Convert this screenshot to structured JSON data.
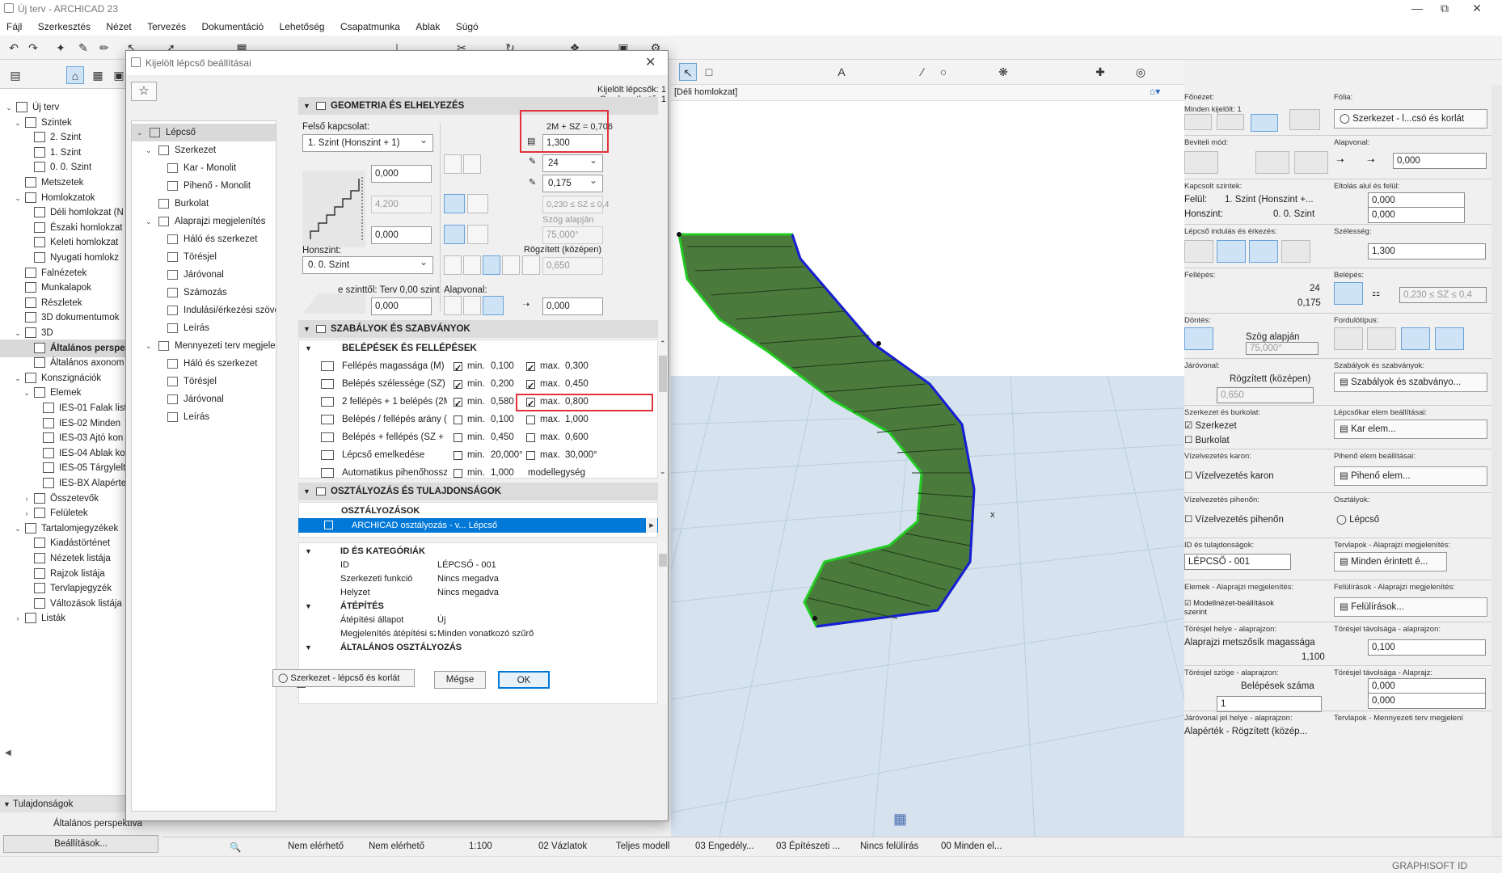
{
  "app": {
    "title": "Új terv - ARCHICAD 23",
    "menu": [
      "Fájl",
      "Szerkesztés",
      "Nézet",
      "Tervezés",
      "Dokumentáció",
      "Lehetőség",
      "Csapatmunka",
      "Ablak",
      "Súgó"
    ]
  },
  "navigator": {
    "items": [
      {
        "label": "Új terv",
        "lvl": 0,
        "ar": "v"
      },
      {
        "label": "Szintek",
        "lvl": 1,
        "ar": "v"
      },
      {
        "label": "2. Szint",
        "lvl": 2,
        "ar": ""
      },
      {
        "label": "1. Szint",
        "lvl": 2,
        "ar": ""
      },
      {
        "label": "0. 0. Szint",
        "lvl": 2,
        "ar": ""
      },
      {
        "label": "Metszetek",
        "lvl": 1,
        "ar": ""
      },
      {
        "label": "Homlokzatok",
        "lvl": 1,
        "ar": "v"
      },
      {
        "label": "Déli homlokzat (N",
        "lvl": 2,
        "ar": ""
      },
      {
        "label": "Északi homlokzat",
        "lvl": 2,
        "ar": ""
      },
      {
        "label": "Keleti homlokzat",
        "lvl": 2,
        "ar": ""
      },
      {
        "label": "Nyugati homlokz",
        "lvl": 2,
        "ar": ""
      },
      {
        "label": "Falnézetek",
        "lvl": 1,
        "ar": ""
      },
      {
        "label": "Munkalapok",
        "lvl": 1,
        "ar": ""
      },
      {
        "label": "Részletek",
        "lvl": 1,
        "ar": ""
      },
      {
        "label": "3D dokumentumok",
        "lvl": 1,
        "ar": ""
      },
      {
        "label": "3D",
        "lvl": 1,
        "ar": "v"
      },
      {
        "label": "Általános perspe",
        "lvl": 2,
        "ar": "",
        "sel": true
      },
      {
        "label": "Általános axonom",
        "lvl": 2,
        "ar": ""
      },
      {
        "label": "Konszignációk",
        "lvl": 1,
        "ar": "v"
      },
      {
        "label": "Elemek",
        "lvl": 2,
        "ar": "v"
      },
      {
        "label": "IES-01 Falak list",
        "lvl": 3,
        "ar": ""
      },
      {
        "label": "IES-02 Minden",
        "lvl": 3,
        "ar": ""
      },
      {
        "label": "IES-03 Ajtó kon",
        "lvl": 3,
        "ar": ""
      },
      {
        "label": "IES-04 Ablak ko",
        "lvl": 3,
        "ar": ""
      },
      {
        "label": "IES-05 Tárgylelt",
        "lvl": 3,
        "ar": ""
      },
      {
        "label": "IES-BX Alapérte",
        "lvl": 3,
        "ar": ""
      },
      {
        "label": "Összetevők",
        "lvl": 2,
        "ar": ">"
      },
      {
        "label": "Felületek",
        "lvl": 2,
        "ar": ">"
      },
      {
        "label": "Tartalomjegyzékek",
        "lvl": 1,
        "ar": "v"
      },
      {
        "label": "Kiadástörténet",
        "lvl": 2,
        "ar": ""
      },
      {
        "label": "Nézetek listája",
        "lvl": 2,
        "ar": ""
      },
      {
        "label": "Rajzok listája",
        "lvl": 2,
        "ar": ""
      },
      {
        "label": "Tervlapjegyzék",
        "lvl": 2,
        "ar": ""
      },
      {
        "label": "Változások listája",
        "lvl": 2,
        "ar": ""
      },
      {
        "label": "Listák",
        "lvl": 1,
        "ar": ">"
      }
    ],
    "properties_header": "Tulajdonságok",
    "properties_view": "Általános perspektíva",
    "settings_button": "Beállítások..."
  },
  "view": {
    "tab": "[Déli homlokzat]"
  },
  "dialog": {
    "title": "Kijelölt lépcső beállításai",
    "selected_label": "Kijelölt lépcsők: 1",
    "editable_label": "Szerkeszthető: 1",
    "tree": [
      {
        "label": "Lépcső",
        "lvl": 0,
        "ar": "v",
        "sel": true
      },
      {
        "label": "Szerkezet",
        "lvl": 1,
        "ar": "v"
      },
      {
        "label": "Kar - Monolit",
        "lvl": 2,
        "ar": ""
      },
      {
        "label": "Pihenő - Monolit",
        "lvl": 2,
        "ar": ""
      },
      {
        "label": "Burkolat",
        "lvl": 1,
        "ar": ""
      },
      {
        "label": "Alaprajzi megjelenítés",
        "lvl": 1,
        "ar": "v"
      },
      {
        "label": "Háló és szerkezet",
        "lvl": 2,
        "ar": ""
      },
      {
        "label": "Törésjel",
        "lvl": 2,
        "ar": ""
      },
      {
        "label": "Járóvonal",
        "lvl": 2,
        "ar": ""
      },
      {
        "label": "Számozás",
        "lvl": 2,
        "ar": ""
      },
      {
        "label": "Indulási/érkezési szöve",
        "lvl": 2,
        "ar": ""
      },
      {
        "label": "Leírás",
        "lvl": 2,
        "ar": ""
      },
      {
        "label": "Mennyezeti terv megjelen",
        "lvl": 1,
        "ar": "v"
      },
      {
        "label": "Háló és szerkezet",
        "lvl": 2,
        "ar": ""
      },
      {
        "label": "Törésjel",
        "lvl": 2,
        "ar": ""
      },
      {
        "label": "Járóvonal",
        "lvl": 2,
        "ar": ""
      },
      {
        "label": "Leírás",
        "lvl": 2,
        "ar": ""
      }
    ],
    "geom": {
      "header": "GEOMETRIA ÉS ELHELYEZÉS",
      "top_link_label": "Felső kapcsolat:",
      "top_link_value": "1. Szint (Honszint + 1)",
      "height_top": "0,000",
      "height_mid": "4,200",
      "height_bottom": "0,000",
      "home_label": "Honszint:",
      "home_value": "0. 0. Szint",
      "from_level_label": "e szinttől: Terv 0,00 szint",
      "from_level_value": "0,000",
      "formula": "2M + SZ = 0,706",
      "width": "1,300",
      "risers": "24",
      "riser_height": "0,175",
      "tread_range": "0,230 ≤ SZ ≤ 0,4",
      "angle_label": "Szög alapján",
      "angle_value": "75,000°",
      "fixed_label": "Rögzített (középen)",
      "walkline_offset": "0,650",
      "baseline_label": "Alapvonal:",
      "baseline_value": "0,000"
    },
    "rules": {
      "header": "SZABÁLYOK ÉS SZABVÁNYOK",
      "sub": "BELÉPÉSEK ÉS FELLÉPÉSEK",
      "rows": [
        {
          "label": "Fellépés magassága (M)",
          "min_on": true,
          "min": "0,100",
          "max_on": true,
          "max": "0,300"
        },
        {
          "label": "Belépés szélessége (SZ)",
          "min_on": true,
          "min": "0,200",
          "max_on": true,
          "max": "0,450"
        },
        {
          "label": "2 fellépés + 1 belépés (2M +",
          "min_on": true,
          "min": "0,580",
          "max_on": true,
          "max": "0,800"
        },
        {
          "label": "Belépés / fellépés arány (SZ /",
          "min_on": false,
          "min": "0,100",
          "max_on": false,
          "max": "1,000"
        },
        {
          "label": "Belépés + fellépés (SZ + M)",
          "min_on": false,
          "min": "0,450",
          "max_on": false,
          "max": "0,600"
        },
        {
          "label": "Lépcső emelkedése",
          "min_on": false,
          "min": "20,000°",
          "max_on": false,
          "max": "30,000°"
        },
        {
          "label": "Automatikus pihenőhossz",
          "min_on": false,
          "min": "1,000",
          "max_on": null,
          "max": "modellegység"
        }
      ],
      "min_label": "min.",
      "max_label": "max."
    },
    "classif": {
      "header": "OSZTÁLYOZÁS ÉS TULAJDONSÁGOK",
      "sub": "OSZTÁLYOZÁSOK",
      "selected_row": "ARCHICAD osztályozás - v... Lépcső",
      "id_header": "ID ÉS KATEGÓRIÁK",
      "rows": [
        {
          "k": "ID",
          "v": "LÉPCSŐ - 001"
        },
        {
          "k": "Szerkezeti funkció",
          "v": "Nincs megadva"
        },
        {
          "k": "Helyzet",
          "v": "Nincs megadva"
        }
      ],
      "reno_header": "ÁTÉPÍTÉS",
      "reno_rows": [
        {
          "k": "Átépítési állapot",
          "v": "Új"
        },
        {
          "k": "Megjelenítés átépítési sz...",
          "v": "Minden vonatkozó szűrő"
        }
      ],
      "general_header": "ÁLTALÁNOS OSZTÁLYOZÁS"
    },
    "footer": {
      "layer": "Szerkezet - lépcső és korlát",
      "cancel": "Mégse",
      "ok": "OK"
    }
  },
  "right": {
    "fonezet": "Főnézet:",
    "folia": "Fólia:",
    "minden_kijelolt": "Minden kijelölt: 1",
    "layer_btn": "Szerkezet - l...csö és korlát",
    "beviteli": "Beviteli mód:",
    "alapvonal": "Alapvonal:",
    "alapvonal_val": "0,000",
    "kapcsolt": "Kapcsolt szintek:",
    "eltolas": "Eltolás alul és felül:",
    "felul_lbl": "Felül:",
    "felul_val": "1. Szint (Honszint +...",
    "honszint_lbl": "Honszint:",
    "honszint_val": "0. 0. Szint",
    "eltolas_top": "0,000",
    "eltolas_bot": "0,000",
    "indulas": "Lépcső indulás és érkezés:",
    "szelesseg": "Szélesség:",
    "szelesseg_val": "1,300",
    "fellepes": "Fellépés:",
    "belepes": "Belépés:",
    "fellepes_n": "24",
    "fellepes_h": "0,175",
    "belepes_range": "0,230 ≤ SZ ≤ 0,4",
    "dontes": "Döntés:",
    "fordulotipus": "Fordulótípus:",
    "szog_alapjan": "Szög alapján",
    "szog_val": "75,000°",
    "jarovonal": "Járóvonal:",
    "szabalyok": "Szabályok és szabványok:",
    "rogzitett": "Rögzített (középen)",
    "jaro_val": "0,650",
    "szabalyok_btn": "Szabályok és szabványo...",
    "szerk_burk": "Szerkezet és burkolat:",
    "karelem_lbl": "Lépcsőkar elem beállításai:",
    "szerkezet_cb": "Szerkezet",
    "burkolat_cb": "Burkolat",
    "karelem_btn": "Kar elem...",
    "viz_karon_lbl": "Vízelvezetés karon:",
    "pihelem_lbl": "Pihenő elem beállításai:",
    "viz_karon_cb": "Vízelvezetés karon",
    "pihelem_btn": "Pihenő elem...",
    "viz_pih_lbl": "Vízelvezetés pihenőn:",
    "osztalyok_lbl": "Osztályok:",
    "viz_pih_cb": "Vízelvezetés pihenőn",
    "osztaly_val": "Lépcső",
    "id_lbl": "ID és tulajdonságok:",
    "tervlap_lbl": "Tervlapok - Alaprajzi megjelenítés:",
    "id_val": "LÉPCSŐ - 001",
    "tervlap_btn": "Minden érintett é...",
    "elemek_lbl": "Elemek - Alaprajzi megjelenítés:",
    "felul_lbl2": "Felülírások - Alaprajzi megjelenítés:",
    "modell_cb": "Modellnézet-beállítások szerint",
    "felul_btn": "Felülírások...",
    "torjel_helye": "Törésjel helye - alaprajzon:",
    "torjel_tav": "Törésjel távolsága - alaprajzon:",
    "metszosik": "Alaprajzi metszősík magassága",
    "metszosik_val": "1,100",
    "torjel_tav_val": "0,100",
    "torjel_szoge": "Törésjel szöge - alaprajzon:",
    "torjel_tav2": "Törésjel távolsága - Alaprajz:",
    "belepesek_szama": "Belépések száma",
    "belepesek_val": "1",
    "torjel_a": "0,000",
    "torjel_b": "0,000",
    "jarovonal_jel": "Járóvonal jel helye - alaprajzon:",
    "tervlap_menny": "Tervlapok - Mennyezeti terv megjelení",
    "alapertek": "Alapérték - Rögzített (közép..."
  },
  "status": {
    "a": "Nem elérhető",
    "b": "Nem elérhető",
    "scale": "1:100",
    "vazlatok": "02 Vázlatok",
    "teljes": "Teljes modell",
    "engedely": "03 Engedély...",
    "epiteszeti": "03 Építészeti ...",
    "felulir": "Nincs felülírás",
    "minden": "00 Minden el..."
  },
  "brand": "GRAPHISOFT ID",
  "colors": {
    "accent": "#0078d7",
    "highlight": "#e0313c",
    "stair_fill": "#4a7a3c",
    "stair_edge": "#22cc22",
    "stair_blue": "#1a1ad8"
  }
}
